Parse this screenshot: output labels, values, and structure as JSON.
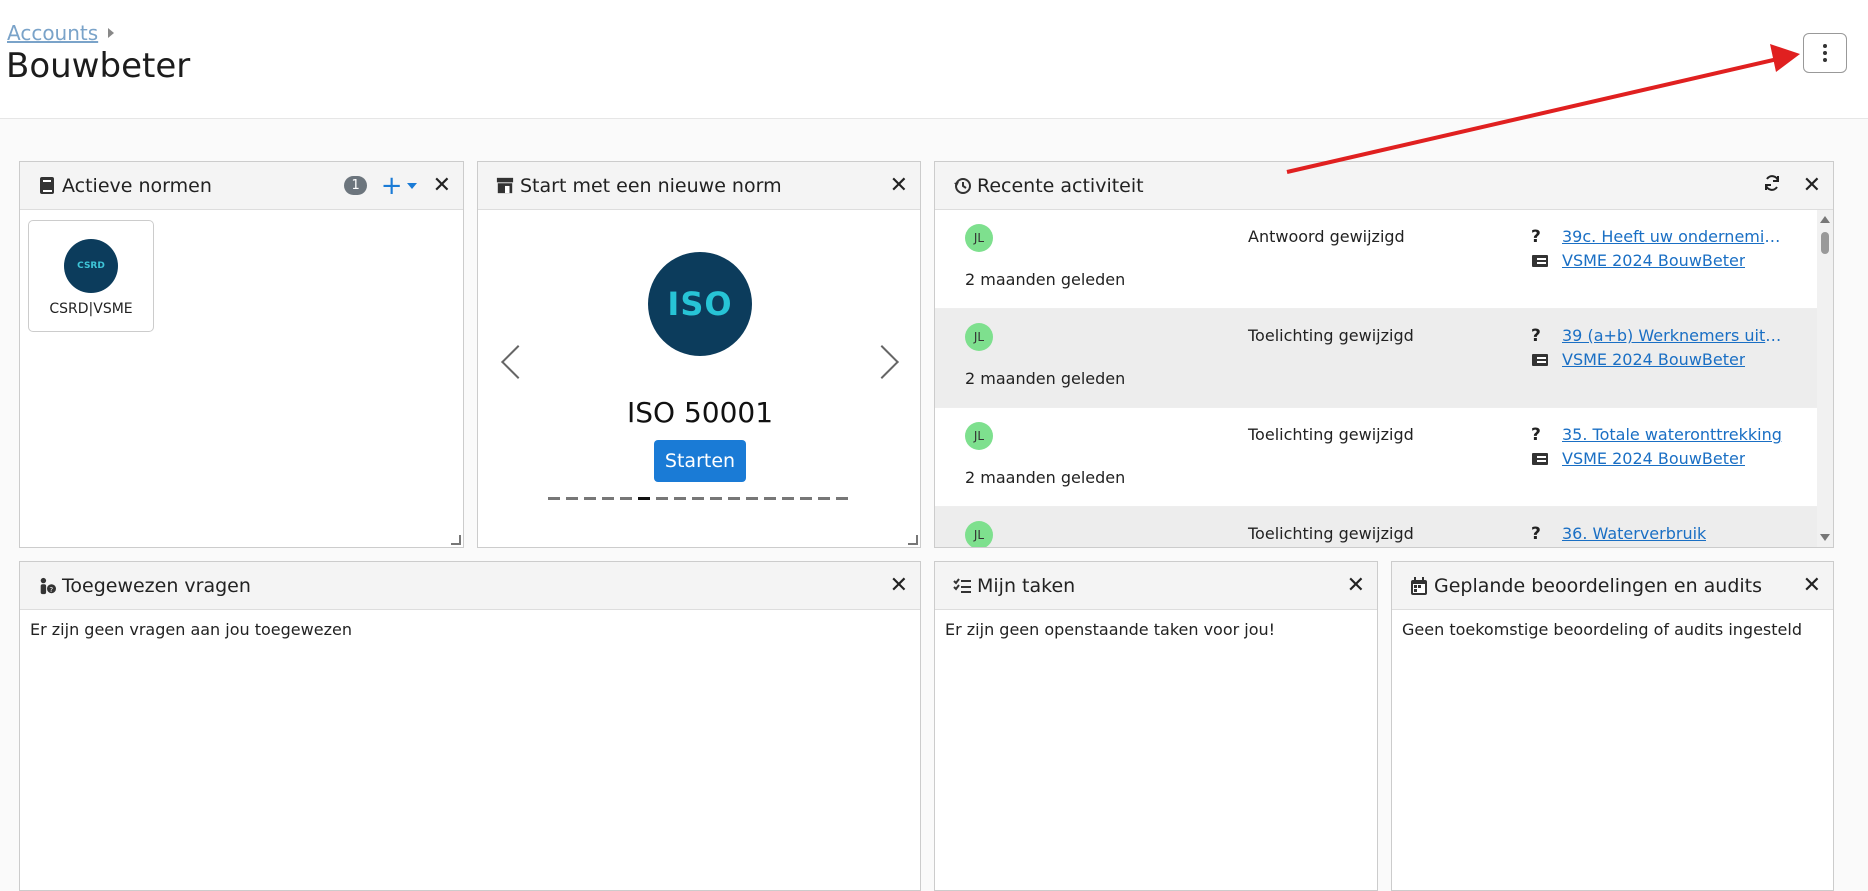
{
  "header": {
    "breadcrumb": "Accounts",
    "title": "Bouwbeter"
  },
  "widgets": {
    "active_norms": {
      "title": "Actieve normen",
      "badge": "1",
      "norm_label": "CSRD|VSME",
      "norm_logo_text": "CSRD"
    },
    "new_norm": {
      "title": "Start met een nieuwe norm",
      "logo_text": "ISO",
      "norm_name": "ISO 50001",
      "start_label": "Starten",
      "slide_count": 17,
      "active_slide": 5
    },
    "recent": {
      "title": "Recente activiteit",
      "rows": [
        {
          "initials": "JL",
          "action": "Antwoord gewijzigd",
          "question": "39c. Heeft uw onderneming...",
          "source": "VSME 2024 BouwBeter",
          "time": "2 maanden geleden"
        },
        {
          "initials": "JL",
          "action": "Toelichting gewijzigd",
          "question": "39 (a+b) Werknemers uitge...",
          "source": "VSME 2024 BouwBeter",
          "time": "2 maanden geleden"
        },
        {
          "initials": "JL",
          "action": "Toelichting gewijzigd",
          "question": "35. Totale wateronttrekking",
          "source": "VSME 2024 BouwBeter",
          "time": "2 maanden geleden"
        },
        {
          "initials": "JL",
          "action": "Toelichting gewijzigd",
          "question": "36. Waterverbruik",
          "source": "",
          "time": ""
        }
      ]
    },
    "assigned": {
      "title": "Toegewezen vragen",
      "empty": "Er zijn geen vragen aan jou toegewezen"
    },
    "tasks": {
      "title": "Mijn taken",
      "empty": "Er zijn geen openstaande taken voor jou!"
    },
    "audits": {
      "title": "Geplande beoordelingen en audits",
      "empty": "Geen toekomstige beoordeling of audits ingesteld"
    }
  },
  "colors": {
    "accent": "#1a7bd6",
    "avatar": "#7ee08e",
    "annotation_arrow": "#e02020"
  }
}
